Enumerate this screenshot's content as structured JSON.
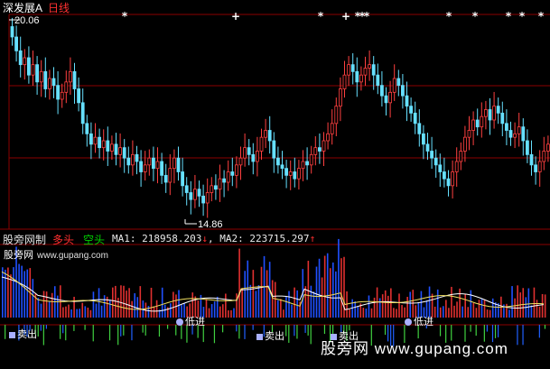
{
  "header": {
    "title": "深发展A",
    "pane": "日线"
  },
  "price_panel": {
    "high_label": "20.06",
    "low_label": "14.86",
    "star_marker": "*",
    "cross_marker": "+"
  },
  "indicator": {
    "name": "股旁网制",
    "bull_label": "多头",
    "bear_label": "空头",
    "ma1_text": "MA1: 218958.203",
    "ma1_arrow": "↓",
    "ma2_text": "MA2: 223715.297",
    "ma2_arrow": "↑"
  },
  "signals": {
    "sell_out": "卖出",
    "low_buy": "低进",
    "sell": "卖出"
  },
  "watermark": {
    "site": "股旁网",
    "url": "www.gupang.com",
    "footer": "股旁网 www.gupang.com"
  },
  "colors": {
    "up": "#ff4040",
    "down": "#66e0ff",
    "grid": "#8b0000",
    "vol_up": "#e03030",
    "vol_down": "#2050ff",
    "line1": "#ffffff",
    "line2": "#f0e060",
    "signal": "#aab0ff"
  },
  "chart_data": {
    "type": "candlestick",
    "price_range": [
      14.86,
      20.06
    ],
    "close": [
      19.7,
      19.3,
      18.9,
      19.1,
      18.6,
      18.9,
      18.4,
      18.7,
      18.2,
      18.5,
      18.3,
      17.9,
      18.1,
      18.4,
      18.7,
      18.2,
      17.8,
      17.2,
      16.9,
      16.6,
      16.8,
      16.5,
      16.7,
      16.4,
      16.6,
      16.3,
      16.5,
      16.2,
      16.0,
      16.3,
      16.1,
      15.8,
      16.0,
      16.2,
      15.9,
      16.1,
      15.7,
      15.5,
      15.9,
      16.2,
      15.8,
      15.4,
      15.2,
      15.0,
      15.3,
      15.1,
      14.9,
      15.2,
      15.4,
      15.3,
      15.6,
      15.5,
      15.8,
      15.7,
      16.0,
      16.2,
      16.5,
      16.3,
      16.1,
      16.4,
      16.8,
      17.0,
      16.7,
      16.2,
      16.0,
      15.9,
      15.7,
      15.8,
      15.6,
      15.9,
      16.1,
      16.0,
      16.3,
      16.5,
      16.4,
      16.7,
      16.9,
      17.2,
      17.7,
      18.2,
      18.6,
      18.9,
      18.7,
      18.4,
      18.6,
      18.8,
      18.9,
      18.6,
      18.3,
      18.0,
      17.8,
      18.1,
      18.5,
      18.3,
      18.0,
      17.7,
      17.5,
      17.2,
      16.9,
      16.6,
      16.4,
      16.2,
      16.0,
      15.8,
      15.6,
      15.4,
      15.8,
      16.1,
      16.4,
      16.8,
      17.0,
      17.3,
      17.1,
      17.4,
      17.6,
      17.3,
      17.7,
      17.5,
      17.2,
      17.0,
      16.8,
      16.9,
      17.1,
      16.7,
      16.3,
      16.0,
      15.8,
      16.1,
      16.4,
      16.6
    ]
  }
}
